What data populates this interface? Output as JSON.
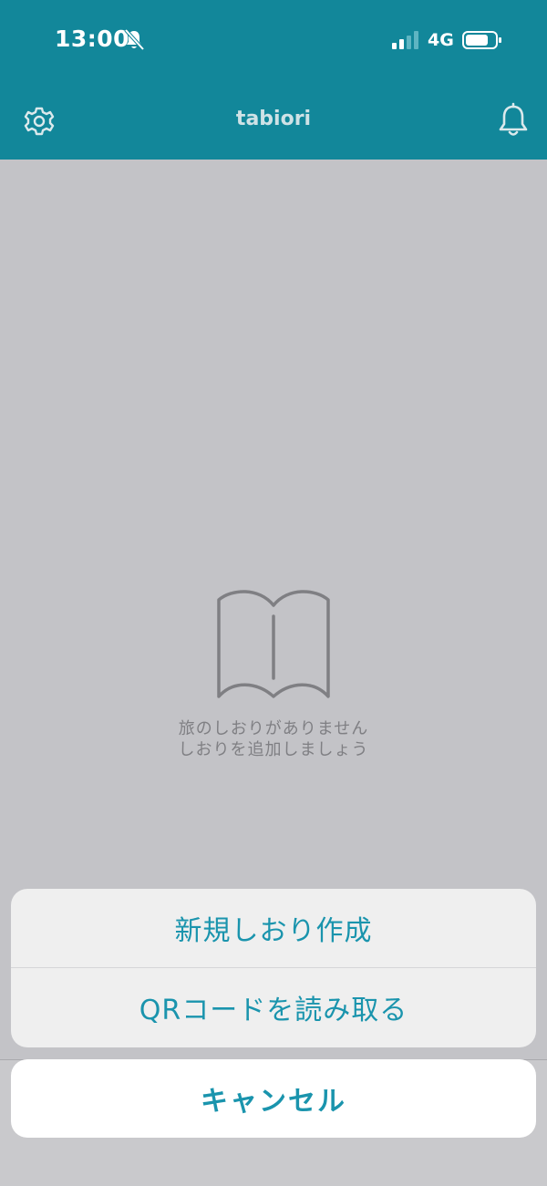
{
  "status_bar": {
    "time": "13:00",
    "network": "4G",
    "silent_icon": "bell-slash-icon",
    "signal_icon": "signal-icon",
    "battery_icon": "battery-icon"
  },
  "nav": {
    "title": "tabiori",
    "left_icon": "gear-icon",
    "right_icon": "bell-icon"
  },
  "empty_state": {
    "icon": "book-icon",
    "line1": "旅のしおりがありません",
    "line2": "しおりを追加しましょう"
  },
  "action_sheet": {
    "options": [
      {
        "label": "新規しおり作成"
      },
      {
        "label": "QRコードを読み取る"
      }
    ],
    "cancel_label": "キャンセル"
  },
  "colors": {
    "header": "#12879a",
    "accent": "#1a94ad",
    "overlay": "#c3c3c7"
  }
}
